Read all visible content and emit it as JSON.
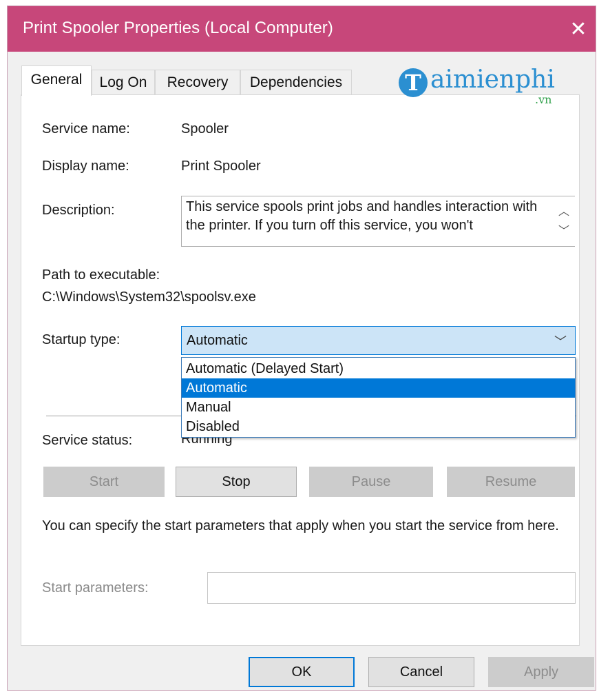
{
  "window": {
    "title": "Print Spooler Properties (Local Computer)",
    "close_glyph": "✕",
    "titlebar_color": "#c7477a"
  },
  "tabs": [
    {
      "label": "General",
      "active": true
    },
    {
      "label": "Log On",
      "active": false
    },
    {
      "label": "Recovery",
      "active": false
    },
    {
      "label": "Dependencies",
      "active": false
    }
  ],
  "watermark": {
    "initial": "T",
    "text": "aimienphi",
    "suffix": ".vn"
  },
  "general": {
    "service_name_label": "Service name:",
    "service_name_value": "Spooler",
    "display_name_label": "Display name:",
    "display_name_value": "Print Spooler",
    "description_label": "Description:",
    "description_value": "This service spools print jobs and handles interaction with the printer.  If you turn off this service, you won't",
    "path_label": "Path to executable:",
    "path_value": "C:\\Windows\\System32\\spoolsv.exe",
    "startup_type_label": "Startup type:",
    "startup_type_value": "Automatic",
    "startup_options": [
      "Automatic (Delayed Start)",
      "Automatic",
      "Manual",
      "Disabled"
    ],
    "startup_selected_index": 1,
    "service_status_label": "Service status:",
    "service_status_value": "Running",
    "buttons": {
      "start": "Start",
      "stop": "Stop",
      "pause": "Pause",
      "resume": "Resume"
    },
    "params_hint": "You can specify the start parameters that apply when you start the service from here.",
    "params_label": "Start parameters:",
    "params_value": ""
  },
  "footer": {
    "ok": "OK",
    "cancel": "Cancel",
    "apply": "Apply"
  },
  "icons": {
    "close": "close-icon",
    "caret": "chevron-down-icon",
    "scroll_up": "chevron-up-icon",
    "scroll_down": "chevron-down-icon"
  }
}
